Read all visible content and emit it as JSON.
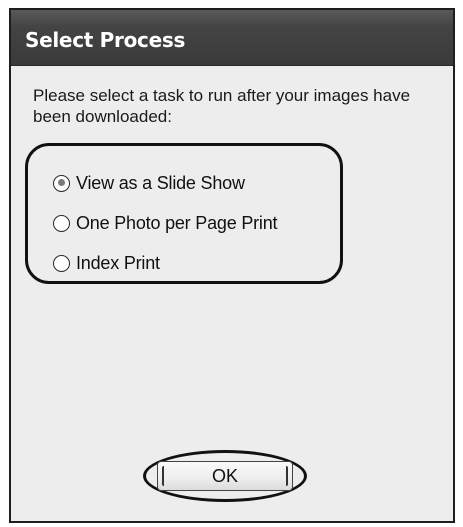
{
  "dialog": {
    "title": "Select Process",
    "prompt": "Please select a task to run after your images have been downloaded:",
    "options": [
      {
        "label": "View as a Slide Show",
        "selected": true
      },
      {
        "label": "One Photo per Page Print",
        "selected": false
      },
      {
        "label": "Index Print",
        "selected": false
      }
    ],
    "ok_label": "OK"
  }
}
